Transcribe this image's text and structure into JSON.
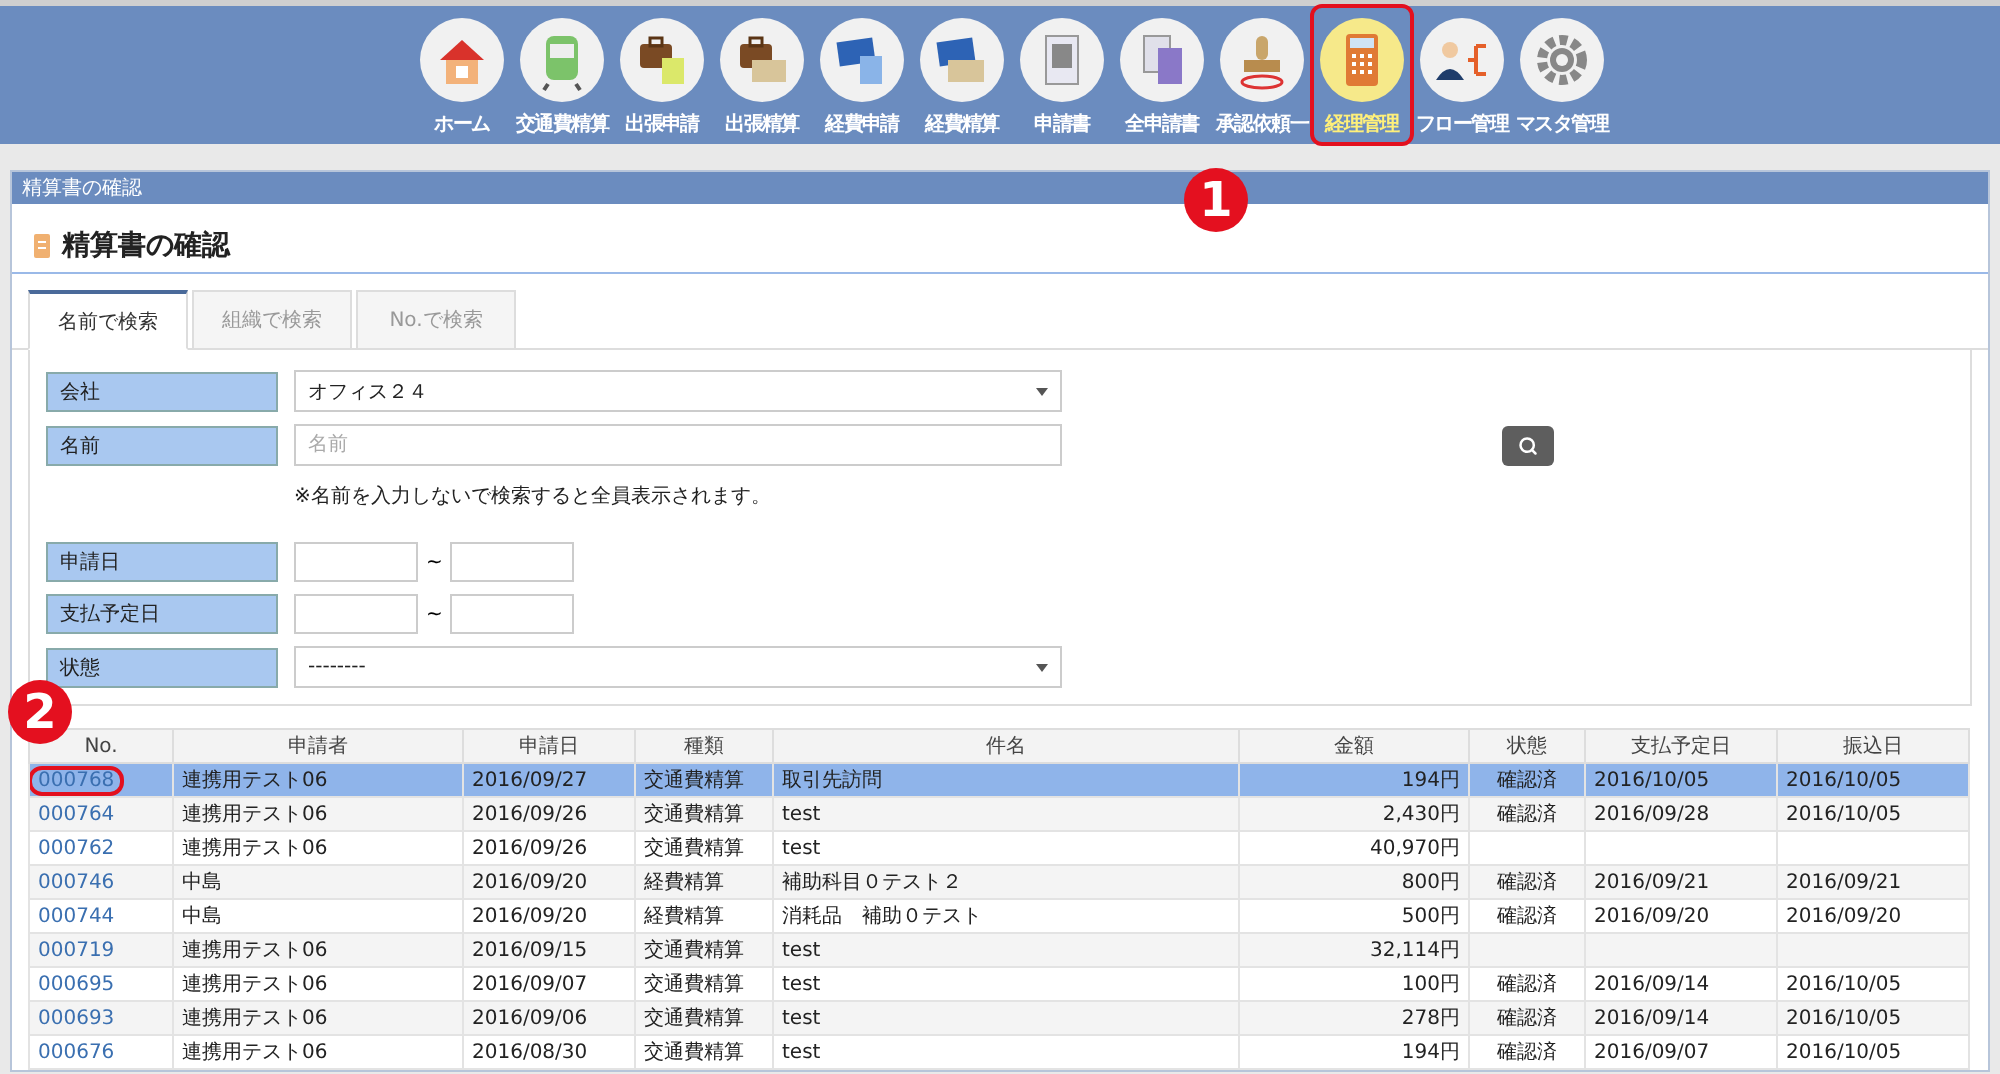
{
  "nav": [
    {
      "label": "ホーム",
      "kind": "home",
      "selected": false,
      "highlighted": false
    },
    {
      "label": "交通費精算",
      "kind": "train",
      "selected": false,
      "highlighted": false
    },
    {
      "label": "出張申請",
      "kind": "bag-doc",
      "selected": false,
      "highlighted": false
    },
    {
      "label": "出張精算",
      "kind": "bag-money",
      "selected": false,
      "highlighted": false
    },
    {
      "label": "経費申請",
      "kind": "card-doc",
      "selected": false,
      "highlighted": false
    },
    {
      "label": "経費精算",
      "kind": "card-money",
      "selected": false,
      "highlighted": false
    },
    {
      "label": "申請書",
      "kind": "sheet",
      "selected": false,
      "highlighted": false
    },
    {
      "label": "全申請書",
      "kind": "sheets",
      "selected": false,
      "highlighted": false
    },
    {
      "label": "承認依頼一",
      "kind": "stamp",
      "selected": false,
      "highlighted": false
    },
    {
      "label": "経理管理",
      "kind": "calculator",
      "selected": true,
      "highlighted": true
    },
    {
      "label": "フロー管理",
      "kind": "person-flow",
      "selected": false,
      "highlighted": false
    },
    {
      "label": "マスタ管理",
      "kind": "gear",
      "selected": false,
      "highlighted": false
    }
  ],
  "panel": {
    "header": "精算書の確認",
    "title": "精算書の確認"
  },
  "tabs": [
    {
      "label": "名前で検索",
      "selected": true
    },
    {
      "label": "組織で検索",
      "selected": false
    },
    {
      "label": "No.で検索",
      "selected": false
    }
  ],
  "form": {
    "company": {
      "label": "会社",
      "value": "オフィス２４"
    },
    "name": {
      "label": "名前",
      "placeholder": "名前"
    },
    "note": "※名前を入力しないで検索すると全員表示されます。",
    "apply_date": {
      "label": "申請日",
      "separator": "~"
    },
    "pay_date": {
      "label": "支払予定日",
      "separator": "~"
    },
    "status": {
      "label": "状態",
      "value": "--------"
    }
  },
  "table": {
    "columns": [
      "No.",
      "申請者",
      "申請日",
      "種類",
      "件名",
      "金額",
      "状態",
      "支払予定日",
      "振込日"
    ],
    "rows": [
      {
        "no": "000768",
        "applicant": "連携用テスト06",
        "date": "2016/09/27",
        "type": "交通費精算",
        "subject": "取引先訪問",
        "amount": "194円",
        "status": "確認済",
        "pay_date": "2016/10/05",
        "transfer_date": "2016/10/05",
        "selected": true,
        "highlighted": true
      },
      {
        "no": "000764",
        "applicant": "連携用テスト06",
        "date": "2016/09/26",
        "type": "交通費精算",
        "subject": "test",
        "amount": "2,430円",
        "status": "確認済",
        "pay_date": "2016/09/28",
        "transfer_date": "2016/10/05",
        "selected": false,
        "highlighted": false
      },
      {
        "no": "000762",
        "applicant": "連携用テスト06",
        "date": "2016/09/26",
        "type": "交通費精算",
        "subject": "test",
        "amount": "40,970円",
        "selected": false,
        "highlighted": false
      },
      {
        "no": "000746",
        "applicant": "中島",
        "date": "2016/09/20",
        "type": "経費精算",
        "subject": "補助科目０テスト２",
        "amount": "800円",
        "status": "確認済",
        "pay_date": "2016/09/21",
        "transfer_date": "2016/09/21",
        "selected": false,
        "highlighted": false
      },
      {
        "no": "000744",
        "applicant": "中島",
        "date": "2016/09/20",
        "type": "経費精算",
        "subject": "消耗品　補助０テスト",
        "amount": "500円",
        "status": "確認済",
        "pay_date": "2016/09/20",
        "transfer_date": "2016/09/20",
        "selected": false,
        "highlighted": false
      },
      {
        "no": "000719",
        "applicant": "連携用テスト06",
        "date": "2016/09/15",
        "type": "交通費精算",
        "subject": "test",
        "amount": "32,114円",
        "selected": false,
        "highlighted": false
      },
      {
        "no": "000695",
        "applicant": "連携用テスト06",
        "date": "2016/09/07",
        "type": "交通費精算",
        "subject": "test",
        "amount": "100円",
        "status": "確認済",
        "pay_date": "2016/09/14",
        "transfer_date": "2016/10/05",
        "selected": false,
        "highlighted": false
      },
      {
        "no": "000693",
        "applicant": "連携用テスト06",
        "date": "2016/09/06",
        "type": "交通費精算",
        "subject": "test",
        "amount": "278円",
        "status": "確認済",
        "pay_date": "2016/09/14",
        "transfer_date": "2016/10/05",
        "selected": false,
        "highlighted": false
      },
      {
        "no": "000676",
        "applicant": "連携用テスト06",
        "date": "2016/08/30",
        "type": "交通費精算",
        "subject": "test",
        "amount": "194円",
        "status": "確認済",
        "pay_date": "2016/09/07",
        "transfer_date": "2016/10/05",
        "selected": false,
        "highlighted": false
      }
    ]
  },
  "callouts": [
    {
      "label": "1",
      "kind": "nav"
    },
    {
      "label": "2",
      "kind": "table"
    }
  ]
}
